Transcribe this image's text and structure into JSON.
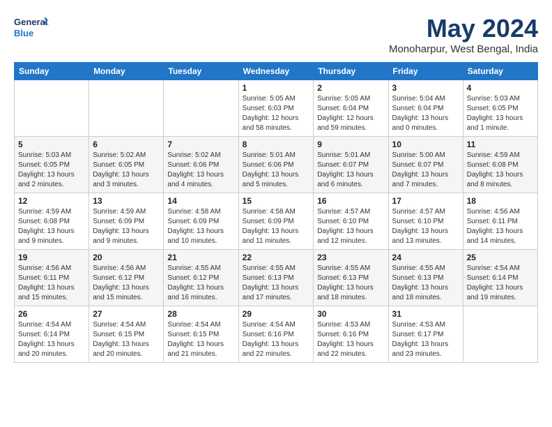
{
  "header": {
    "logo_line1": "General",
    "logo_line2": "Blue",
    "month_title": "May 2024",
    "location": "Monoharpur, West Bengal, India"
  },
  "weekdays": [
    "Sunday",
    "Monday",
    "Tuesday",
    "Wednesday",
    "Thursday",
    "Friday",
    "Saturday"
  ],
  "weeks": [
    [
      {
        "day": "",
        "info": ""
      },
      {
        "day": "",
        "info": ""
      },
      {
        "day": "",
        "info": ""
      },
      {
        "day": "1",
        "info": "Sunrise: 5:05 AM\nSunset: 6:03 PM\nDaylight: 12 hours\nand 58 minutes."
      },
      {
        "day": "2",
        "info": "Sunrise: 5:05 AM\nSunset: 6:04 PM\nDaylight: 12 hours\nand 59 minutes."
      },
      {
        "day": "3",
        "info": "Sunrise: 5:04 AM\nSunset: 6:04 PM\nDaylight: 13 hours\nand 0 minutes."
      },
      {
        "day": "4",
        "info": "Sunrise: 5:03 AM\nSunset: 6:05 PM\nDaylight: 13 hours\nand 1 minute."
      }
    ],
    [
      {
        "day": "5",
        "info": "Sunrise: 5:03 AM\nSunset: 6:05 PM\nDaylight: 13 hours\nand 2 minutes."
      },
      {
        "day": "6",
        "info": "Sunrise: 5:02 AM\nSunset: 6:05 PM\nDaylight: 13 hours\nand 3 minutes."
      },
      {
        "day": "7",
        "info": "Sunrise: 5:02 AM\nSunset: 6:06 PM\nDaylight: 13 hours\nand 4 minutes."
      },
      {
        "day": "8",
        "info": "Sunrise: 5:01 AM\nSunset: 6:06 PM\nDaylight: 13 hours\nand 5 minutes."
      },
      {
        "day": "9",
        "info": "Sunrise: 5:01 AM\nSunset: 6:07 PM\nDaylight: 13 hours\nand 6 minutes."
      },
      {
        "day": "10",
        "info": "Sunrise: 5:00 AM\nSunset: 6:07 PM\nDaylight: 13 hours\nand 7 minutes."
      },
      {
        "day": "11",
        "info": "Sunrise: 4:59 AM\nSunset: 6:08 PM\nDaylight: 13 hours\nand 8 minutes."
      }
    ],
    [
      {
        "day": "12",
        "info": "Sunrise: 4:59 AM\nSunset: 6:08 PM\nDaylight: 13 hours\nand 9 minutes."
      },
      {
        "day": "13",
        "info": "Sunrise: 4:59 AM\nSunset: 6:09 PM\nDaylight: 13 hours\nand 9 minutes."
      },
      {
        "day": "14",
        "info": "Sunrise: 4:58 AM\nSunset: 6:09 PM\nDaylight: 13 hours\nand 10 minutes."
      },
      {
        "day": "15",
        "info": "Sunrise: 4:58 AM\nSunset: 6:09 PM\nDaylight: 13 hours\nand 11 minutes."
      },
      {
        "day": "16",
        "info": "Sunrise: 4:57 AM\nSunset: 6:10 PM\nDaylight: 13 hours\nand 12 minutes."
      },
      {
        "day": "17",
        "info": "Sunrise: 4:57 AM\nSunset: 6:10 PM\nDaylight: 13 hours\nand 13 minutes."
      },
      {
        "day": "18",
        "info": "Sunrise: 4:56 AM\nSunset: 6:11 PM\nDaylight: 13 hours\nand 14 minutes."
      }
    ],
    [
      {
        "day": "19",
        "info": "Sunrise: 4:56 AM\nSunset: 6:11 PM\nDaylight: 13 hours\nand 15 minutes."
      },
      {
        "day": "20",
        "info": "Sunrise: 4:56 AM\nSunset: 6:12 PM\nDaylight: 13 hours\nand 15 minutes."
      },
      {
        "day": "21",
        "info": "Sunrise: 4:55 AM\nSunset: 6:12 PM\nDaylight: 13 hours\nand 16 minutes."
      },
      {
        "day": "22",
        "info": "Sunrise: 4:55 AM\nSunset: 6:13 PM\nDaylight: 13 hours\nand 17 minutes."
      },
      {
        "day": "23",
        "info": "Sunrise: 4:55 AM\nSunset: 6:13 PM\nDaylight: 13 hours\nand 18 minutes."
      },
      {
        "day": "24",
        "info": "Sunrise: 4:55 AM\nSunset: 6:13 PM\nDaylight: 13 hours\nand 18 minutes."
      },
      {
        "day": "25",
        "info": "Sunrise: 4:54 AM\nSunset: 6:14 PM\nDaylight: 13 hours\nand 19 minutes."
      }
    ],
    [
      {
        "day": "26",
        "info": "Sunrise: 4:54 AM\nSunset: 6:14 PM\nDaylight: 13 hours\nand 20 minutes."
      },
      {
        "day": "27",
        "info": "Sunrise: 4:54 AM\nSunset: 6:15 PM\nDaylight: 13 hours\nand 20 minutes."
      },
      {
        "day": "28",
        "info": "Sunrise: 4:54 AM\nSunset: 6:15 PM\nDaylight: 13 hours\nand 21 minutes."
      },
      {
        "day": "29",
        "info": "Sunrise: 4:54 AM\nSunset: 6:16 PM\nDaylight: 13 hours\nand 22 minutes."
      },
      {
        "day": "30",
        "info": "Sunrise: 4:53 AM\nSunset: 6:16 PM\nDaylight: 13 hours\nand 22 minutes."
      },
      {
        "day": "31",
        "info": "Sunrise: 4:53 AM\nSunset: 6:17 PM\nDaylight: 13 hours\nand 23 minutes."
      },
      {
        "day": "",
        "info": ""
      }
    ]
  ]
}
